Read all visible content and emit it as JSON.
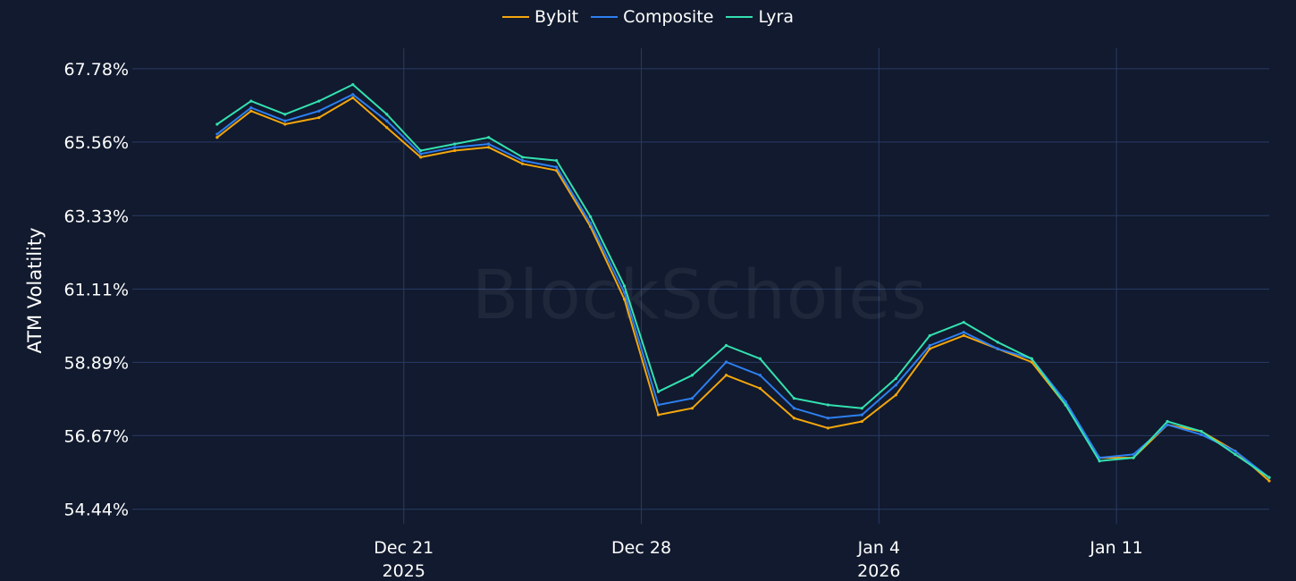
{
  "watermark": "BlockScholes",
  "chart_data": {
    "type": "line",
    "title": "",
    "ylabel": "ATM Volatility",
    "xlabel": "",
    "legend_position": "top-center",
    "grid": true,
    "x_range": [
      "2025-12-13T00:00",
      "2026-01-15T12:00"
    ],
    "ylim": [
      54.0,
      68.4
    ],
    "y_ticks": [
      54.44,
      56.67,
      58.89,
      61.11,
      63.33,
      65.56,
      67.78
    ],
    "y_tick_labels": [
      "54.44%",
      "56.67%",
      "58.89%",
      "61.11%",
      "63.33%",
      "65.56%",
      "67.78%"
    ],
    "x_ticks": [
      {
        "date": "2025-12-21",
        "label": "Dec 21",
        "year": "2025"
      },
      {
        "date": "2025-12-28",
        "label": "Dec 28",
        "year": ""
      },
      {
        "date": "2026-01-04",
        "label": "Jan 4",
        "year": "2026"
      },
      {
        "date": "2026-01-11",
        "label": "Jan 11",
        "year": ""
      }
    ],
    "series": [
      {
        "name": "Bybit",
        "color": "#f4a60d",
        "x": [
          "2025-12-15T12:00",
          "2025-12-16T12:00",
          "2025-12-17T12:00",
          "2025-12-18T12:00",
          "2025-12-19T12:00",
          "2025-12-20T12:00",
          "2025-12-21T12:00",
          "2025-12-22T12:00",
          "2025-12-23T12:00",
          "2025-12-24T12:00",
          "2025-12-25T12:00",
          "2025-12-26T12:00",
          "2025-12-27T12:00",
          "2025-12-28T12:00",
          "2025-12-29T12:00",
          "2025-12-30T12:00",
          "2025-12-31T12:00",
          "2026-01-01T12:00",
          "2026-01-02T12:00",
          "2026-01-03T12:00",
          "2026-01-04T12:00",
          "2026-01-05T12:00",
          "2026-01-06T12:00",
          "2026-01-07T12:00",
          "2026-01-08T12:00",
          "2026-01-09T12:00",
          "2026-01-10T12:00",
          "2026-01-11T12:00",
          "2026-01-12T12:00",
          "2026-01-13T12:00",
          "2026-01-14T12:00",
          "2026-01-15T12:00"
        ],
        "values": [
          65.7,
          66.5,
          66.1,
          66.3,
          66.9,
          66.0,
          65.1,
          65.3,
          65.4,
          64.9,
          64.7,
          63.0,
          60.8,
          57.3,
          57.5,
          58.5,
          58.1,
          57.2,
          56.9,
          57.1,
          57.9,
          59.3,
          59.7,
          59.3,
          58.9,
          57.6,
          56.0,
          56.0,
          57.0,
          56.8,
          56.2,
          55.3
        ]
      },
      {
        "name": "Composite",
        "color": "#2d7ff0",
        "x": [
          "2025-12-15T12:00",
          "2025-12-16T12:00",
          "2025-12-17T12:00",
          "2025-12-18T12:00",
          "2025-12-19T12:00",
          "2025-12-20T12:00",
          "2025-12-21T12:00",
          "2025-12-22T12:00",
          "2025-12-23T12:00",
          "2025-12-24T12:00",
          "2025-12-25T12:00",
          "2025-12-26T12:00",
          "2025-12-27T12:00",
          "2025-12-28T12:00",
          "2025-12-29T12:00",
          "2025-12-30T12:00",
          "2025-12-31T12:00",
          "2026-01-01T12:00",
          "2026-01-02T12:00",
          "2026-01-03T12:00",
          "2026-01-04T12:00",
          "2026-01-05T12:00",
          "2026-01-06T12:00",
          "2026-01-07T12:00",
          "2026-01-08T12:00",
          "2026-01-09T12:00",
          "2026-01-10T12:00",
          "2026-01-11T12:00",
          "2026-01-12T12:00",
          "2026-01-13T12:00",
          "2026-01-14T12:00",
          "2026-01-15T12:00"
        ],
        "values": [
          65.8,
          66.6,
          66.2,
          66.5,
          67.0,
          66.2,
          65.2,
          65.4,
          65.5,
          65.0,
          64.8,
          63.1,
          61.0,
          57.6,
          57.8,
          58.9,
          58.5,
          57.5,
          57.2,
          57.3,
          58.2,
          59.4,
          59.8,
          59.3,
          59.0,
          57.7,
          56.0,
          56.1,
          57.0,
          56.7,
          56.2,
          55.4
        ]
      },
      {
        "name": "Lyra",
        "color": "#33e1b0",
        "x": [
          "2025-12-15T12:00",
          "2025-12-16T12:00",
          "2025-12-17T12:00",
          "2025-12-18T12:00",
          "2025-12-19T12:00",
          "2025-12-20T12:00",
          "2025-12-21T12:00",
          "2025-12-22T12:00",
          "2025-12-23T12:00",
          "2025-12-24T12:00",
          "2025-12-25T12:00",
          "2025-12-26T12:00",
          "2025-12-27T12:00",
          "2025-12-28T12:00",
          "2025-12-29T12:00",
          "2025-12-30T12:00",
          "2025-12-31T12:00",
          "2026-01-01T12:00",
          "2026-01-02T12:00",
          "2026-01-03T12:00",
          "2026-01-04T12:00",
          "2026-01-05T12:00",
          "2026-01-06T12:00",
          "2026-01-07T12:00",
          "2026-01-08T12:00",
          "2026-01-09T12:00",
          "2026-01-10T12:00",
          "2026-01-11T12:00",
          "2026-01-12T12:00",
          "2026-01-13T12:00",
          "2026-01-14T12:00",
          "2026-01-15T12:00"
        ],
        "values": [
          66.1,
          66.8,
          66.4,
          66.8,
          67.3,
          66.4,
          65.3,
          65.5,
          65.7,
          65.1,
          65.0,
          63.3,
          61.2,
          58.0,
          58.5,
          59.4,
          59.0,
          57.8,
          57.6,
          57.5,
          58.4,
          59.7,
          60.1,
          59.5,
          59.0,
          57.6,
          55.9,
          56.0,
          57.1,
          56.8,
          56.1,
          55.4
        ]
      }
    ]
  }
}
